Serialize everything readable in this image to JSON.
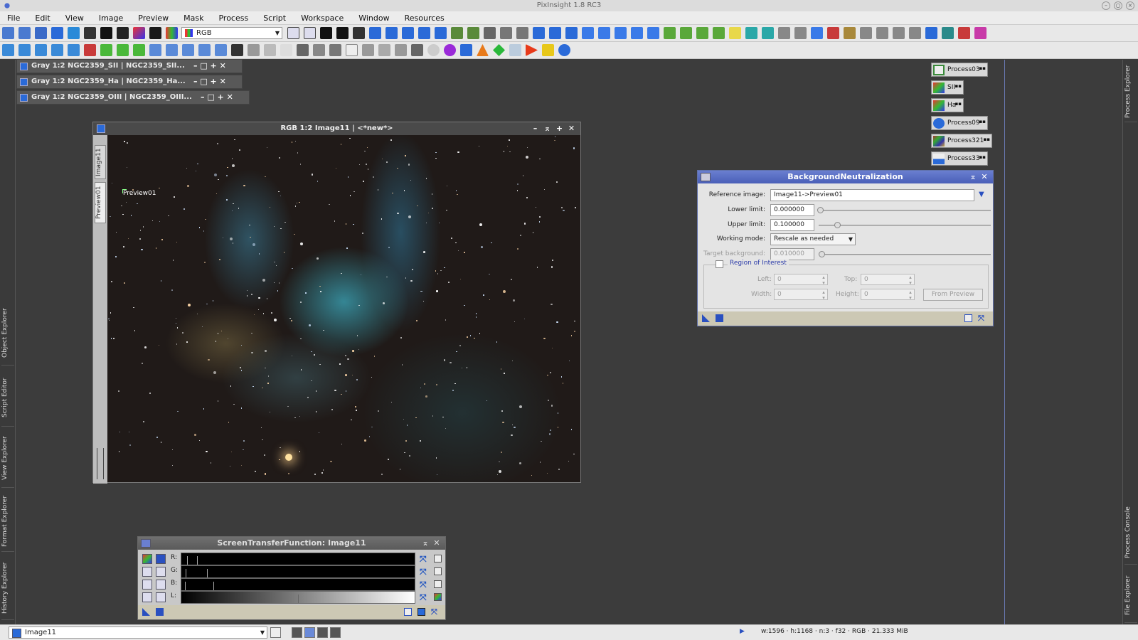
{
  "app": {
    "title": "PixInsight 1.8 RC3"
  },
  "menu": [
    "File",
    "Edit",
    "View",
    "Image",
    "Preview",
    "Mask",
    "Process",
    "Script",
    "Workspace",
    "Window",
    "Resources"
  ],
  "toolbar": {
    "rgb_mode": "RGB"
  },
  "left_panels": [
    "Object Explorer",
    "Script Editor",
    "View Explorer",
    "Format Explorer",
    "History Explorer"
  ],
  "right_panels": [
    "Process Explorer",
    "Process Console",
    "File Explorer"
  ],
  "shaded_windows": [
    "Gray 1:2 NGC2359_SII | NGC2359_SII...",
    "Gray 1:2 NGC2359_Ha | NGC2359_Ha...",
    "Gray 1:2 NGC2359_OIII | NGC2359_OIII..."
  ],
  "image_window": {
    "title": "RGB 1:2 Image11 | <*new*>",
    "tabs": [
      "Image11",
      "Preview01"
    ],
    "preview_label": "Preview01"
  },
  "process_icons": [
    "Process03",
    "SII",
    "Ha",
    "Process09",
    "Process321",
    "Process33"
  ],
  "bg_neutralization": {
    "title": "BackgroundNeutralization",
    "reference_label": "Reference image:",
    "reference_value": "Image11->Preview01",
    "lower_label": "Lower limit:",
    "lower_value": "0.000000",
    "lower_pos": 0.0,
    "upper_label": "Upper limit:",
    "upper_value": "0.100000",
    "upper_pos": 0.1,
    "mode_label": "Working mode:",
    "mode_value": "Rescale as needed",
    "target_label": "Target background:",
    "target_value": "0.010000",
    "target_pos": 0.01,
    "roi_title": "Region of Interest",
    "left_label": "Left:",
    "left_value": "0",
    "top_label": "Top:",
    "top_value": "0",
    "width_label": "Width:",
    "width_value": "0",
    "height_label": "Height:",
    "height_value": "0",
    "from_preview": "From Preview"
  },
  "stf": {
    "title": "ScreenTransferFunction: Image11",
    "channels": [
      "R:",
      "G:",
      "B:",
      "L:"
    ]
  },
  "statusbar": {
    "view": "Image11",
    "info": "w:1596 · h:1168 · n:3 · f32 · RGB · 21.333 MiB"
  }
}
